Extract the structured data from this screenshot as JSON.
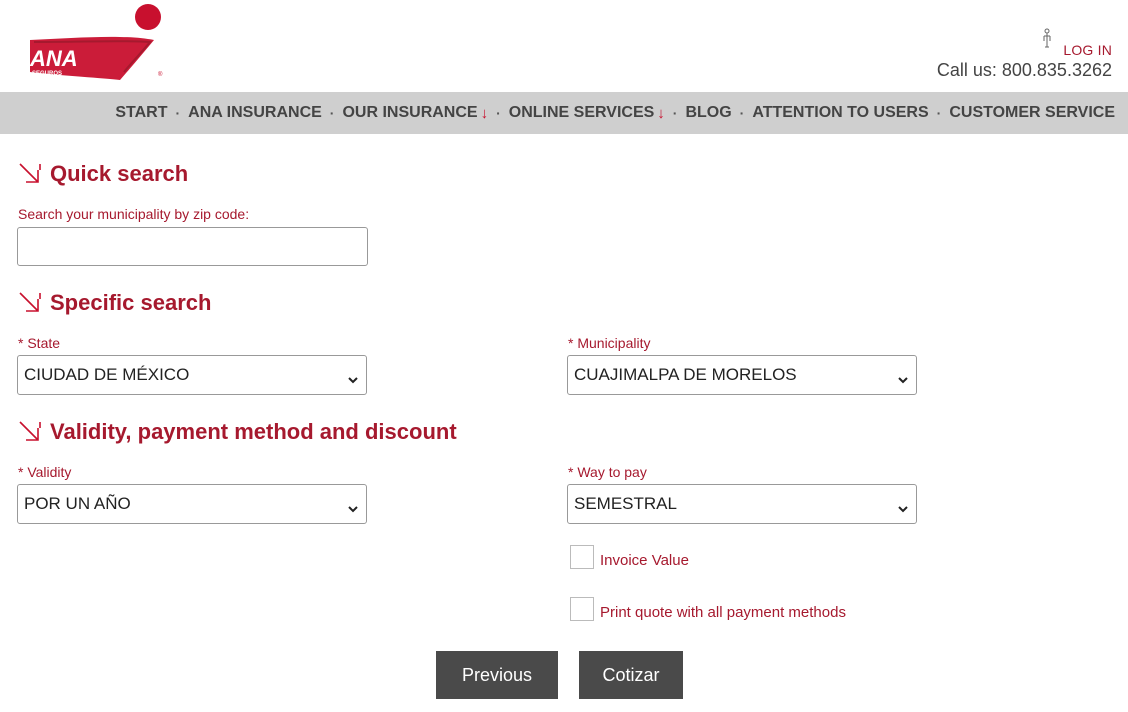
{
  "brand": {
    "name": "ANA",
    "subtitle": "SEGUROS",
    "accent_color": "#a6192e",
    "nav_bg": "#cfcfcf",
    "button_bg": "#4a4a4a"
  },
  "header": {
    "login_label": "LOG IN",
    "call_text": "Call us: 800.835.3262"
  },
  "nav": {
    "items": [
      {
        "label": "START",
        "dropdown": false
      },
      {
        "label": "ANA INSURANCE",
        "dropdown": false
      },
      {
        "label": "OUR INSURANCE",
        "dropdown": true
      },
      {
        "label": "ONLINE SERVICES",
        "dropdown": true
      },
      {
        "label": "BLOG",
        "dropdown": false
      },
      {
        "label": "ATTENTION TO USERS",
        "dropdown": false
      },
      {
        "label": "CUSTOMER SERVICE",
        "dropdown": false
      }
    ],
    "dropdown_glyph": "↓",
    "separator": "·"
  },
  "quick_search": {
    "title": "Quick search",
    "zip_label": "Search your municipality by zip code:",
    "zip_value": ""
  },
  "specific_search": {
    "title": "Specific search",
    "state_label": "* State",
    "state_value": "CIUDAD DE MÉXICO",
    "municipality_label": "* Municipality",
    "municipality_value": "CUAJIMALPA DE MORELOS"
  },
  "validity_section": {
    "title": "Validity, payment method and discount",
    "validity_label": "* Validity",
    "validity_value": "POR UN AÑO",
    "pay_label": "* Way to pay",
    "pay_value": "SEMESTRAL",
    "invoice_label": "Invoice Value",
    "invoice_checked": false,
    "print_label": "Print quote with all payment methods",
    "print_checked": false
  },
  "buttons": {
    "previous_label": "Previous",
    "cotizar_label": "Cotizar"
  }
}
